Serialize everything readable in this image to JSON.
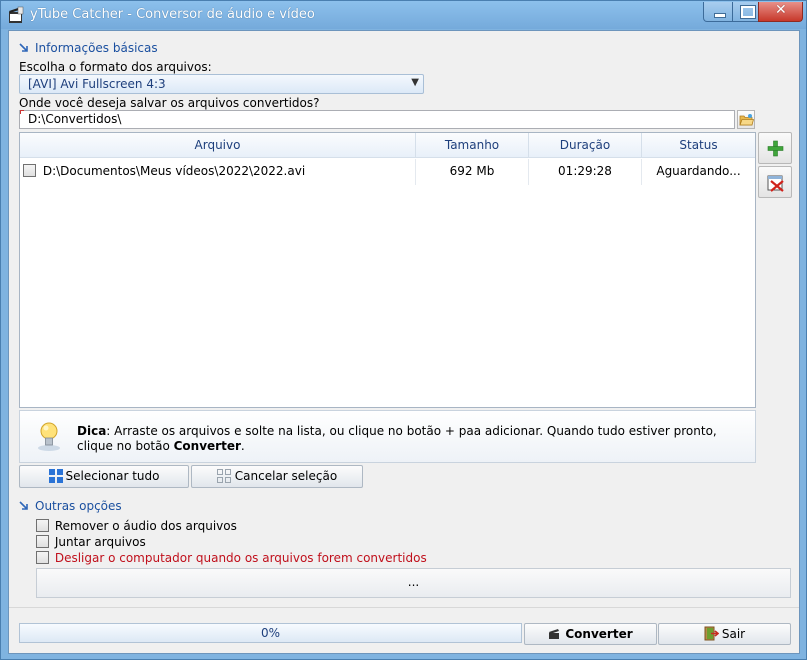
{
  "window": {
    "title": "yTube Catcher - Conversor de áudio e vídeo"
  },
  "basic": {
    "section_title": "Informações básicas",
    "format_label": "Escolha o formato dos arquivos:",
    "format_value": "[AVI] Avi Fullscreen 4:3",
    "save_label": "Onde você deseja salvar os arquivos convertidos?",
    "save_path": "D:\\Convertidos\\"
  },
  "table": {
    "columns": [
      "Arquivo",
      "Tamanho",
      "Duração",
      "Status"
    ],
    "rows": [
      {
        "file": "D:\\Documentos\\Meus vídeos\\2022\\2022.avi",
        "size": "692 Mb",
        "duration": "01:29:28",
        "status": "Aguardando..."
      }
    ]
  },
  "tip": {
    "label": "Dica",
    "text_1": ": Arraste os arquivos e solte na lista, ou clique no botão + paa adicionar. Quando tudo estiver pronto, clique no botão ",
    "bold_word": "Converter",
    "text_2": "."
  },
  "selection": {
    "select_all": "Selecionar tudo",
    "cancel": "Cancelar seleção"
  },
  "options": {
    "section_title": "Outras opções",
    "items": [
      {
        "label": "Remover o áudio dos arquivos",
        "checked": false
      },
      {
        "label": "Juntar arquivos",
        "checked": false
      },
      {
        "label": "Desligar o computador quando os arquivos forem convertidos",
        "checked": false
      }
    ],
    "more_label": "..."
  },
  "footer": {
    "progress_text": "0%",
    "progress_value": 0,
    "convert_label": "Converter",
    "exit_label": "Sair"
  },
  "colors": {
    "accent": "#1a4f9f",
    "warning": "#c0101c"
  }
}
